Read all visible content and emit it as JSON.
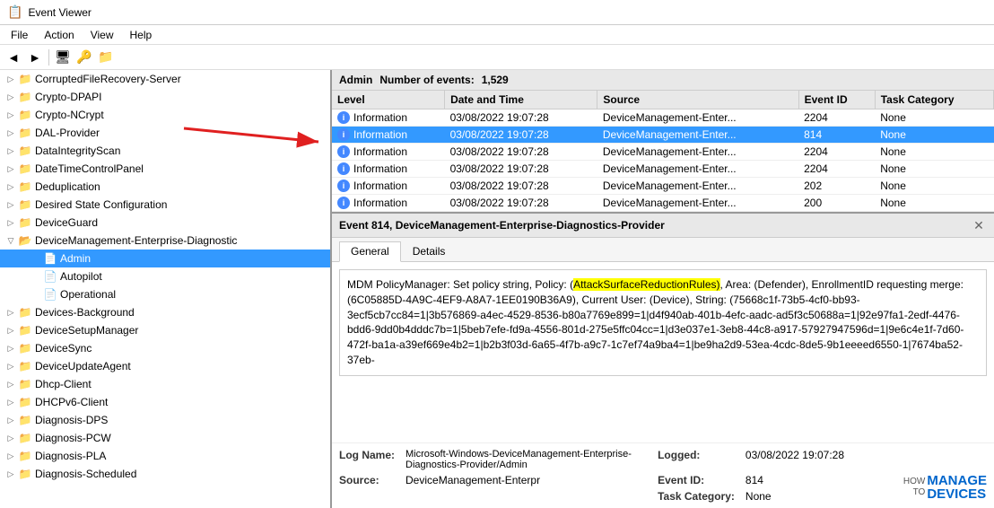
{
  "app": {
    "title": "Event Viewer",
    "icon": "📋"
  },
  "menu": {
    "items": [
      "File",
      "Action",
      "View",
      "Help"
    ]
  },
  "toolbar": {
    "buttons": [
      "←",
      "→",
      "📋",
      "🖥",
      "🔑",
      "📁"
    ]
  },
  "tree": {
    "items": [
      {
        "label": "CorruptedFileRecovery-Server",
        "level": 1,
        "expanded": false,
        "type": "folder"
      },
      {
        "label": "Crypto-DPAPI",
        "level": 1,
        "expanded": false,
        "type": "folder"
      },
      {
        "label": "Crypto-NCrypt",
        "level": 1,
        "expanded": false,
        "type": "folder"
      },
      {
        "label": "DAL-Provider",
        "level": 1,
        "expanded": false,
        "type": "folder"
      },
      {
        "label": "DataIntegrityScan",
        "level": 1,
        "expanded": false,
        "type": "folder"
      },
      {
        "label": "DateTimeControlPanel",
        "level": 1,
        "expanded": false,
        "type": "folder"
      },
      {
        "label": "Deduplication",
        "level": 1,
        "expanded": false,
        "type": "folder"
      },
      {
        "label": "Desired State Configuration",
        "level": 1,
        "expanded": false,
        "type": "folder"
      },
      {
        "label": "DeviceGuard",
        "level": 1,
        "expanded": false,
        "type": "folder"
      },
      {
        "label": "DeviceManagement-Enterprise-Diagnostic",
        "level": 1,
        "expanded": true,
        "type": "folder"
      },
      {
        "label": "Admin",
        "level": 2,
        "expanded": false,
        "type": "log",
        "selected": true
      },
      {
        "label": "Autopilot",
        "level": 2,
        "expanded": false,
        "type": "log"
      },
      {
        "label": "Operational",
        "level": 2,
        "expanded": false,
        "type": "log"
      },
      {
        "label": "Devices-Background",
        "level": 1,
        "expanded": false,
        "type": "folder"
      },
      {
        "label": "DeviceSetupManager",
        "level": 1,
        "expanded": false,
        "type": "folder"
      },
      {
        "label": "DeviceSync",
        "level": 1,
        "expanded": false,
        "type": "folder"
      },
      {
        "label": "DeviceUpdateAgent",
        "level": 1,
        "expanded": false,
        "type": "folder"
      },
      {
        "label": "Dhcp-Client",
        "level": 1,
        "expanded": false,
        "type": "folder"
      },
      {
        "label": "DHCPv6-Client",
        "level": 1,
        "expanded": false,
        "type": "folder"
      },
      {
        "label": "Diagnosis-DPS",
        "level": 1,
        "expanded": false,
        "type": "folder"
      },
      {
        "label": "Diagnosis-PCW",
        "level": 1,
        "expanded": false,
        "type": "folder"
      },
      {
        "label": "Diagnosis-PLA",
        "level": 1,
        "expanded": false,
        "type": "folder"
      },
      {
        "label": "Diagnosis-Scheduled",
        "level": 1,
        "expanded": false,
        "type": "folder"
      }
    ]
  },
  "events_panel": {
    "header_name": "Admin",
    "events_count_label": "Number of events:",
    "events_count": "1,529",
    "columns": [
      "Level",
      "Date and Time",
      "Source",
      "Event ID",
      "Task Category"
    ],
    "rows": [
      {
        "level": "Information",
        "datetime": "03/08/2022 19:07:28",
        "source": "DeviceManagement-Enter...",
        "event_id": "2204",
        "task": "None",
        "selected": false
      },
      {
        "level": "Information",
        "datetime": "03/08/2022 19:07:28",
        "source": "DeviceManagement-Enter...",
        "event_id": "814",
        "task": "None",
        "selected": true
      },
      {
        "level": "Information",
        "datetime": "03/08/2022 19:07:28",
        "source": "DeviceManagement-Enter...",
        "event_id": "2204",
        "task": "None",
        "selected": false
      },
      {
        "level": "Information",
        "datetime": "03/08/2022 19:07:28",
        "source": "DeviceManagement-Enter...",
        "event_id": "2204",
        "task": "None",
        "selected": false
      },
      {
        "level": "Information",
        "datetime": "03/08/2022 19:07:28",
        "source": "DeviceManagement-Enter...",
        "event_id": "202",
        "task": "None",
        "selected": false
      },
      {
        "level": "Information",
        "datetime": "03/08/2022 19:07:28",
        "source": "DeviceManagement-Enter...",
        "event_id": "200",
        "task": "None",
        "selected": false
      }
    ]
  },
  "detail_panel": {
    "header": "Event 814, DeviceManagement-Enterprise-Diagnostics-Provider",
    "tabs": [
      "General",
      "Details"
    ],
    "active_tab": "General",
    "event_text_before_highlight": "MDM PolicyManager: Set policy string, Policy: (",
    "event_text_highlight": "AttackSurfaceReductionRules)",
    "event_text_after": ", Area: (Defender), EnrollmentID requesting merge: (6C05885D-4A9C-4EF9-A8A7-1EE0190B36A9), Current User: (Device), String: (75668c1f-73b5-4cf0-bb93-3ecf5cb7cc84=1|3b576869-a4ec-4529-8536-b80a7769e899=1|d4f940ab-401b-4efc-aadc-ad5f3c50688a=1|92e97fa1-2edf-4476-bdd6-9dd0b4dddc7b=1|5beb7efe-fd9a-4556-801d-275e5ffc04cc=1|d3e037e1-3eb8-44c8-a917-57927947596d=1|9e6c4e1f-7d60-472f-ba1a-a39ef669e4b2=1|b2b3f03d-6a65-4f7b-a9c7-1c7ef74a9ba4=1|be9ha2d9-53ea-4cdc-8de5-9b1eeeed6550-1|7674ba52-37eb-",
    "footer": {
      "log_name_label": "Log Name:",
      "log_name_value": "Microsoft-Windows-DeviceManagement-Enterprise-Diagnostics-Provider/Admin",
      "source_label": "Source:",
      "source_value": "DeviceManagement-Enterpr",
      "logged_label": "Logged:",
      "logged_value": "03/08/2022 19:07:28",
      "event_id_label": "Event ID:",
      "event_id_value": "814",
      "task_category_label": "Task Category:",
      "task_category_value": "None"
    }
  },
  "brand": {
    "how_to": "HOW\nTO",
    "manage": "MANAGE",
    "devices": "DEVICES"
  }
}
